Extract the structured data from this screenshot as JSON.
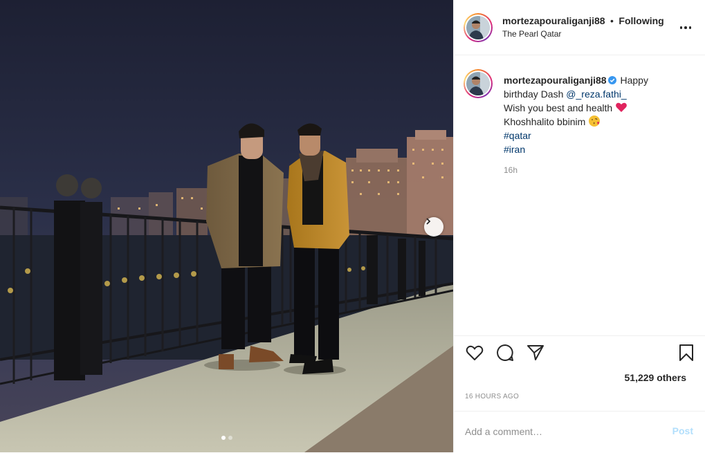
{
  "colors": {
    "link": "#00376b",
    "secondary_text": "#8e8e8e",
    "post_button_disabled": "#b2dffc",
    "verified_badge": "#3897f0",
    "heart_emoji": "#e0245e"
  },
  "header": {
    "username": "mortezapouraliganji88",
    "separator": "•",
    "follow_status": "Following",
    "location": "The Pearl Qatar",
    "more_icon": "more-horizontal-icon"
  },
  "media": {
    "description_icon": "photo",
    "carousel_dots": 2,
    "active_dot": 0,
    "next_icon": "chevron-right-icon"
  },
  "caption": {
    "username": "mortezapouraliganji88",
    "verified_icon": "verified-badge-icon",
    "text_line1_start": "Happy",
    "text_line1_rest": "birthday Dash",
    "mention": "@_reza.fathi_",
    "line2": "Wish you best and health",
    "line2_emoji": "red-heart-emoji",
    "line3": "Khoshhalito bbinim",
    "line3_emoji": "kissing-face-emoji",
    "hashtags": [
      "#qatar",
      "#iran"
    ],
    "time": "16h"
  },
  "actions": {
    "like_icon": "heart-outline-icon",
    "comment_icon": "comment-bubble-icon",
    "share_icon": "paper-plane-icon",
    "save_icon": "bookmark-icon",
    "likes_text": "51,229 others",
    "timestamp": "16 HOURS AGO"
  },
  "comment": {
    "placeholder": "Add a comment…",
    "post_label": "Post"
  }
}
